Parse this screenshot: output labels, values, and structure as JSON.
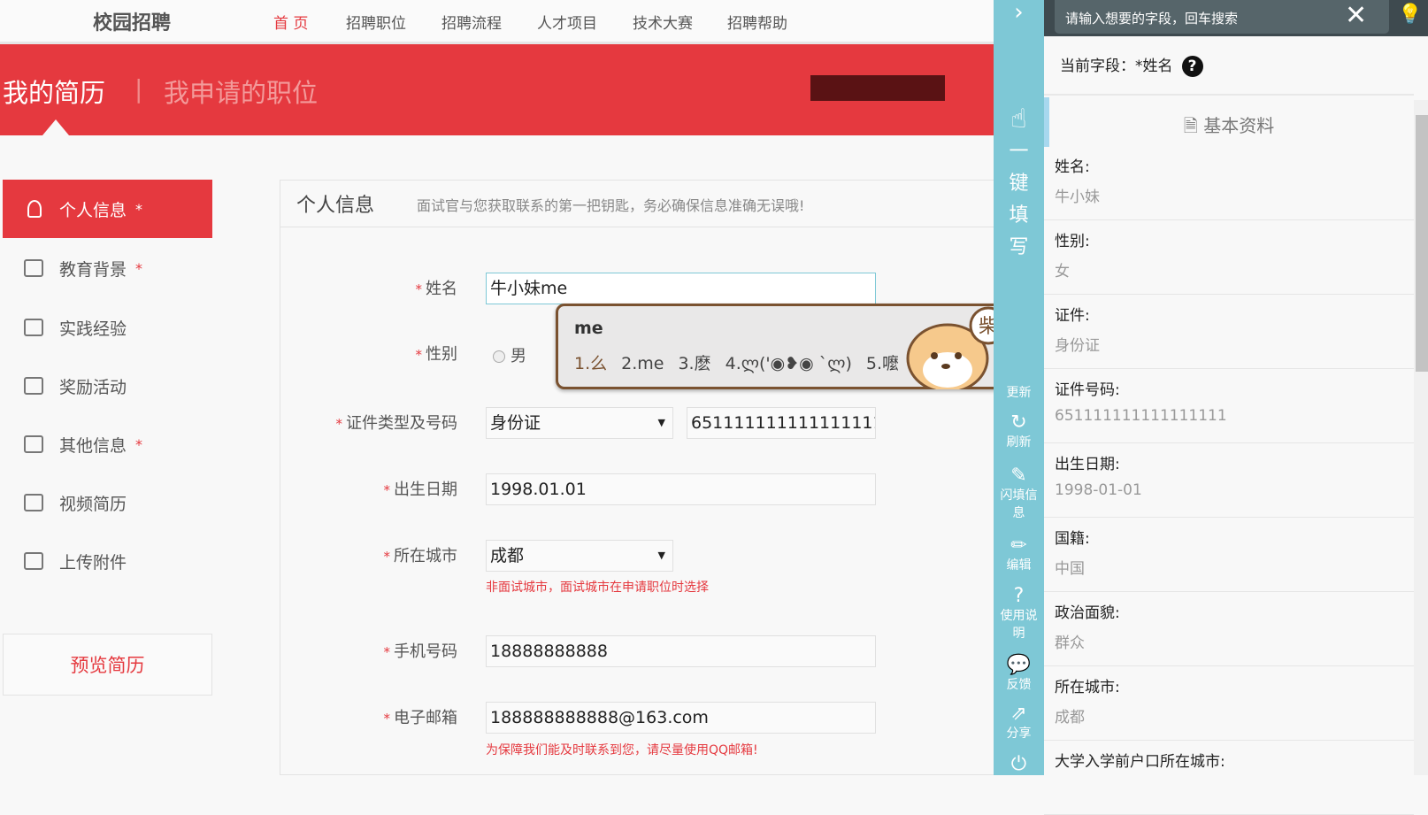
{
  "topnav": {
    "logo": "校园招聘",
    "items": [
      "首 页",
      "招聘职位",
      "招聘流程",
      "人才项目",
      "技术大赛",
      "招聘帮助"
    ]
  },
  "banner": {
    "tab_active": "我的简历",
    "separator": "|",
    "tab_other": "我申请的职位"
  },
  "sidebar": {
    "items": [
      {
        "label": "个人信息",
        "required": "*",
        "icon": "user-icon"
      },
      {
        "label": "教育背景",
        "required": "*",
        "icon": "book-icon"
      },
      {
        "label": "实践经验",
        "required": "",
        "icon": "edit-icon"
      },
      {
        "label": "奖励活动",
        "required": "",
        "icon": "trophy-icon"
      },
      {
        "label": "其他信息",
        "required": "*",
        "icon": "list-icon"
      },
      {
        "label": "视频简历",
        "required": "",
        "icon": "video-icon"
      },
      {
        "label": "上传附件",
        "required": "",
        "icon": "attachment-icon"
      }
    ],
    "preview": "预览简历"
  },
  "form": {
    "title": "个人信息",
    "hint": "面试官与您获取联系的第一把钥匙，务必确保信息准确无误哦!",
    "star": "*",
    "name": {
      "label": "姓名",
      "value": "牛小妹me"
    },
    "gender": {
      "label": "性别",
      "option_male": "男"
    },
    "id": {
      "label": "证件类型及号码",
      "type": "身份证",
      "number": "651111111111111111"
    },
    "birth": {
      "label": "出生日期",
      "value": "1998.01.01"
    },
    "city": {
      "label": "所在城市",
      "value": "成都",
      "hint": "非面试城市，面试城市在申请职位时选择"
    },
    "phone": {
      "label": "手机号码",
      "value": "18888888888"
    },
    "email": {
      "label": "电子邮箱",
      "value": "188888888888@163.com",
      "hint": "为保障我们能及时联系到您，请尽量使用QQ邮箱!"
    }
  },
  "ime": {
    "input": "me",
    "candidates": [
      "1.么",
      "2.me",
      "3.麽",
      "4.ლ('◉❥◉ `ლ)",
      "5.嚒"
    ],
    "badge": "柴"
  },
  "toolbar": {
    "main": [
      "一",
      "键",
      "填",
      "写"
    ],
    "items": [
      "更新",
      "刷新",
      "闪填信息",
      "编辑",
      "使用说明",
      "反馈",
      "分享"
    ]
  },
  "rightpanel": {
    "search_placeholder": "请输入想要的字段，回车搜索",
    "current_label": "当前字段：",
    "current_value": "*姓名",
    "section": "基本资料",
    "fields": [
      {
        "label": "姓名:",
        "value": "牛小妹"
      },
      {
        "label": "性别:",
        "value": "女"
      },
      {
        "label": "证件:",
        "value": "身份证"
      },
      {
        "label": "证件号码:",
        "value": "651111111111111111"
      },
      {
        "label": "出生日期:",
        "value": "1998-01-01"
      },
      {
        "label": "国籍:",
        "value": "中国"
      },
      {
        "label": "政治面貌:",
        "value": "群众"
      },
      {
        "label": "所在城市:",
        "value": "成都"
      },
      {
        "label": "大学入学前户口所在城市:",
        "value": ""
      }
    ]
  }
}
